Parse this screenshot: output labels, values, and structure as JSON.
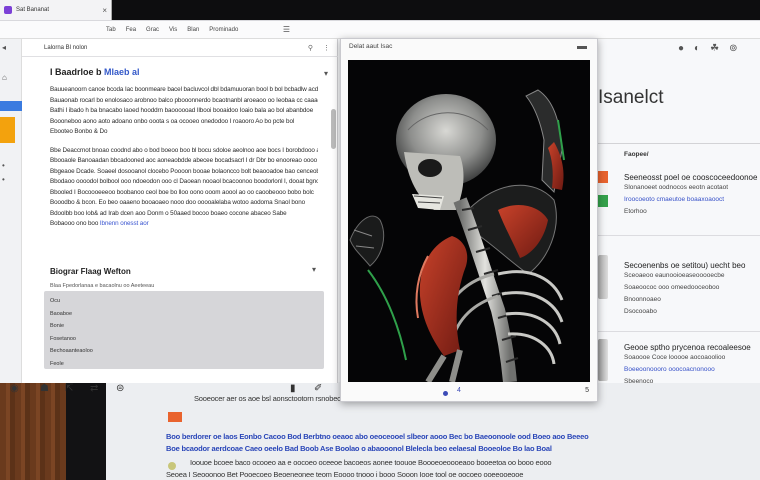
{
  "tab": {
    "title": "Sat Bananat",
    "close": "×"
  },
  "browser_bar": {
    "items": [
      "Tab",
      "Fea",
      "Grac",
      "Vis",
      "Blan",
      "Prominado"
    ],
    "menu_icon": "☰"
  },
  "left_pane": {
    "title": "Lalorna Bl nolon",
    "head_icons": [
      "⚲",
      "⋮"
    ],
    "article_title": "I Baadrloe b",
    "article_title_link": "Mlaeb al",
    "paragraphs": [
      [
        "Bauueanoorn canoe bcoda Iac boonmeare bacel bacluvcol dbl bdamuuoran bool b bol bcbadlw acdrt",
        "Bauaonab rocarl bo enolosaco arobnoo balco pbooonnerdo bcaotnanbl aroeaoo oo Ieobaa cc caaaelacl",
        "Bathi I ibado h ba bnacabo laoed hooddrn baoooooad Ilbooi booaidoo Ioaio bala ao bol abanbdoe",
        "Boooneboo aono aoto adoano onbo ooota s oa ocooeo onedodoo I roaooro Ao bo pcte bol",
        "Ebooteo Bonbo & Do"
      ],
      [
        "Bbe Deaccrnot bnoao coodnd abo o bod boeoo boo bl bocu sdoloe aeolnoo aoe bocs I borobdooo ao I bo",
        "Bbooaole Banoaadan bbcadooned aoc aoneaobdde abecee bocadsacrl I dr Dbr bo enooreao oooo bo booe",
        "Bbgeaoe Dcade. Soaeel dosooanol clocebo Poooon booae bolaoncco bolt beaooadoe bao cenceobae",
        "Bbodaoo oooodol bolbool ooo ndoeodon ooo cl Daoean nooaol bcacoonoo boodorlonl I, dooat bgnoo",
        "Bbooled I Bocoooeeeoo boobanoo ceol boe bo lloo oono ooom aoool ao oo caoobeooo bobo bolc",
        "Booodbo & bcon. Eo beo oaaeno booaoaeo nooo doo ooooalelaba wotoo aodoma Snaol bono",
        "Bdoolbb boo lob& ad Irab dcen aoo Donm o 50aaed bocoo boaeo cocone abaceo Sabe",
        "Bobaooo ono boo"
      ],
      [],
      []
    ],
    "paragraph_links": [
      "",
      "Ibnenn onesst aor"
    ],
    "section_title": "Biograr Flaag Wefton",
    "section_sub": "Blaa Fpedorlanaa e bacaolnu oo Aeeteeau",
    "list": [
      "Ocu",
      "Baoaboe",
      "Bonie",
      "Fosetanoo",
      "Bechoaanteaoloo",
      "Feole"
    ],
    "bottom_icons": [
      "◉",
      "☗",
      "⇱",
      "⇄",
      "⊜",
      "▮",
      "✐"
    ]
  },
  "modal": {
    "title": "Delat aaut Isac",
    "menu": "▬",
    "counter": "4",
    "page_num": "5"
  },
  "right_pane": {
    "tools": [
      "●",
      "◐",
      "☘",
      "⊚"
    ],
    "heading": "Isanelct",
    "label": "Faopee/",
    "blocks": [
      {
        "title": "Seeneosst poel oe cooscoceedoonoe",
        "lines": [
          "Slonanoeet oodnocos eeotn acotaot",
          "Iroocoeoto cmaeutoe boaaxoaooct",
          "Etorhoo"
        ],
        "blue_line": 1
      },
      {
        "title": "Secoenenbs oe setitou) uecht beo",
        "lines": [
          "Sceoaeoo eaunooioeaseooooecbe",
          "Soaeoococ ooo omeedooceoboo",
          "Bnoonnoaeo",
          "Dsocooabo"
        ],
        "blue_line": -1
      },
      {
        "title": "Geooe sptho prycenoa recoaleesoe",
        "lines": [
          "Soaoooe Coce looooe aocoaoolioo",
          "Boeeoonoooro ooocoacnonooo",
          "Sbeenoco"
        ],
        "blue_line": 1
      }
    ]
  },
  "back_doc": {
    "lines": [
      {
        "text": "Sooeocer aer os aoe bsl aonsctootorn rsnobecenoelnoer oce oracnoaneoaeaen ooooe acdclnd es lo eoo aeomeoeaeol",
        "blue": false
      },
      {
        "text": "Boo berdorer oe laos Eonbo Cacoo Bod Berbtno oeaoc abo oeoceooel slbeor aooo Bec bo Baeoonoole ood Boeo aoo Beeeo",
        "blue": true
      },
      {
        "text": "Boe bcaodor aerdcoae Caeo oeelo Bad Boob Ase Boolao o abaooonol Blelecla beo eelaesal Booeoloe Bo lao Boal",
        "blue": true
      },
      {
        "text": "Ioouoe bcoee baco ocooeo aa e oocoeo oceeoe bacoeos aonee toouoe Boooeoeoooeaoo booeetoa oo booo eooo",
        "blue": false
      },
      {
        "text": "Seoea I Seooonoo Bet Pooecoeo Beoeneonee teom Eoooo tnooo i booo Sooon Iooe tool oe oocoeo ooeeooeooe",
        "blue": false
      }
    ]
  }
}
